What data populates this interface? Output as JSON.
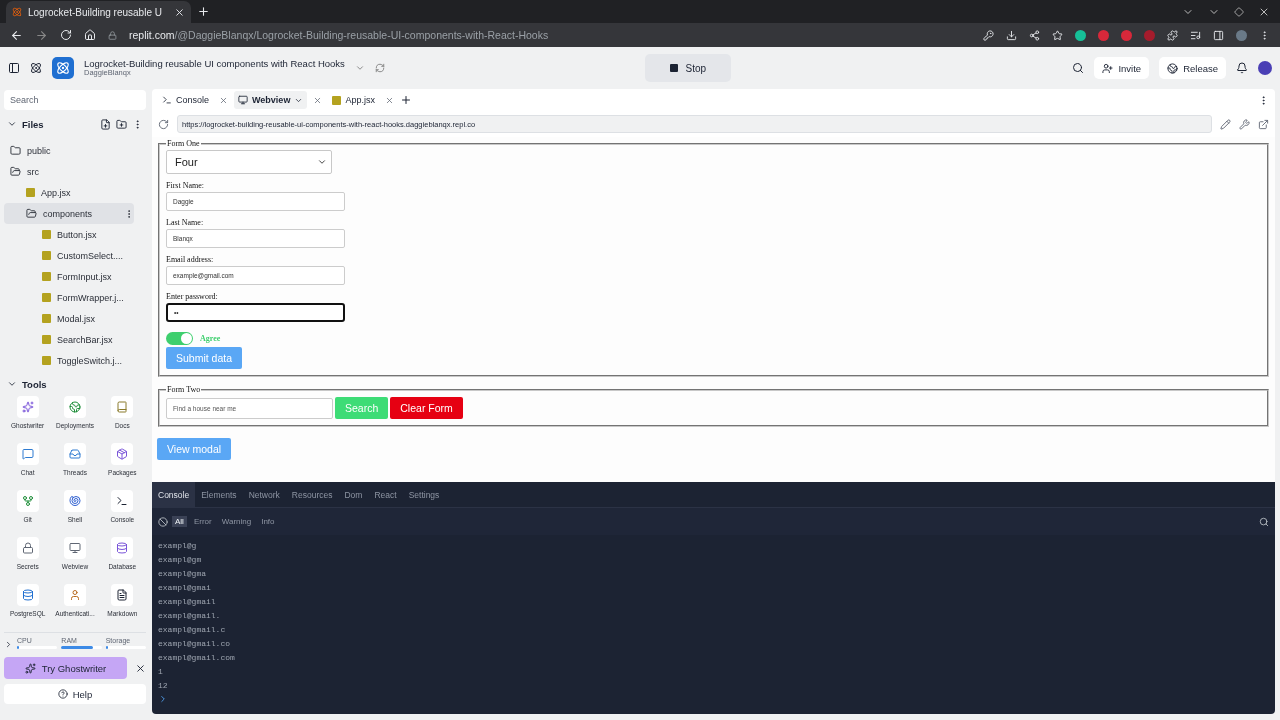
{
  "browser": {
    "tab_title": "Logrocket-Building reusable U",
    "url_host": "replit.com",
    "url_path": "/@DaggieBlanqx/Logrocket-Building-reusable-UI-components-with-React-Hooks"
  },
  "header": {
    "repl_title": "Logrocket-Building reusable UI components with React Hooks",
    "owner": "DaggieBlanqx",
    "run_button": "Stop",
    "invite_button": "Invite",
    "release_button": "Release"
  },
  "sidebar": {
    "search_placeholder": "Search",
    "files_title": "Files",
    "files": [
      {
        "kind": "folder",
        "name": "public",
        "selected": false
      },
      {
        "kind": "folder",
        "name": "src",
        "selected": false,
        "children": [
          {
            "kind": "file",
            "name": "App.jsx",
            "selected": false
          },
          {
            "kind": "folder",
            "name": "components",
            "selected": true,
            "children": [
              {
                "kind": "file",
                "name": "Button.jsx",
                "selected": false
              },
              {
                "kind": "file",
                "name": "CustomSelect....",
                "selected": false
              },
              {
                "kind": "file",
                "name": "FormInput.jsx",
                "selected": false
              },
              {
                "kind": "file",
                "name": "FormWrapper.j...",
                "selected": false
              },
              {
                "kind": "file",
                "name": "Modal.jsx",
                "selected": false
              },
              {
                "kind": "file",
                "name": "SearchBar.jsx",
                "selected": false
              },
              {
                "kind": "file",
                "name": "ToggleSwitch.j...",
                "selected": false
              }
            ]
          }
        ]
      }
    ],
    "tools_title": "Tools",
    "tools": [
      {
        "label": "Ghostwriter"
      },
      {
        "label": "Deployments"
      },
      {
        "label": "Docs"
      },
      {
        "label": "Chat"
      },
      {
        "label": "Threads"
      },
      {
        "label": "Packages"
      },
      {
        "label": "Git"
      },
      {
        "label": "Shell"
      },
      {
        "label": "Console"
      },
      {
        "label": "Secrets"
      },
      {
        "label": "Webview"
      },
      {
        "label": "Database"
      },
      {
        "label": "PostgreSQL"
      },
      {
        "label": "Authenticati..."
      },
      {
        "label": "Markdown"
      }
    ],
    "resources": [
      {
        "label": "CPU",
        "level": 0.05
      },
      {
        "label": "RAM",
        "level": 0.78
      },
      {
        "label": "Storage",
        "level": 0.06
      }
    ],
    "ghostwriter_button": "Try Ghostwriter",
    "help_button": "Help"
  },
  "editor_tabs": [
    {
      "label": "Console",
      "selected": false
    },
    {
      "label": "Webview",
      "selected": true
    },
    {
      "label": "App.jsx",
      "selected": false
    }
  ],
  "webview": {
    "url": "https://logrocket-building-reusable-ui-components-with-react-hooks.daggieblanqx.repl.co",
    "form_one": {
      "legend": "Form One",
      "select_value": "Four",
      "fields": [
        {
          "label": "First Name:",
          "value": "Daggie",
          "focused": false
        },
        {
          "label": "Last Name:",
          "value": "Blanqx",
          "focused": false
        },
        {
          "label": "Email address:",
          "value": "example@gmail.com",
          "focused": false
        },
        {
          "label": "Enter password:",
          "value": "••",
          "focused": true
        }
      ],
      "toggle": {
        "on": true,
        "label": "Agree"
      },
      "submit_button": "Submit data"
    },
    "form_two": {
      "legend": "Form Two",
      "search_placeholder": "Find a house near me",
      "search_button": "Search",
      "clear_button": "Clear Form"
    },
    "modal_button": "View modal"
  },
  "devtools": {
    "tabs": [
      {
        "label": "Console",
        "selected": true
      },
      {
        "label": "Elements",
        "selected": false
      },
      {
        "label": "Network",
        "selected": false
      },
      {
        "label": "Resources",
        "selected": false
      },
      {
        "label": "Dom",
        "selected": false
      },
      {
        "label": "React",
        "selected": false
      },
      {
        "label": "Settings",
        "selected": false
      }
    ],
    "filters": [
      {
        "label": "All",
        "selected": true
      },
      {
        "label": "Error",
        "selected": false
      },
      {
        "label": "Warning",
        "selected": false
      },
      {
        "label": "Info",
        "selected": false
      }
    ],
    "logs": [
      "exampl@g",
      "exampl@gm",
      "exampl@gma",
      "exampl@gmai",
      "exampl@gmail",
      "exampl@gmail.",
      "exampl@gmail.c",
      "exampl@gmail.co",
      "exampl@gmail.com",
      "1",
      "12"
    ]
  }
}
